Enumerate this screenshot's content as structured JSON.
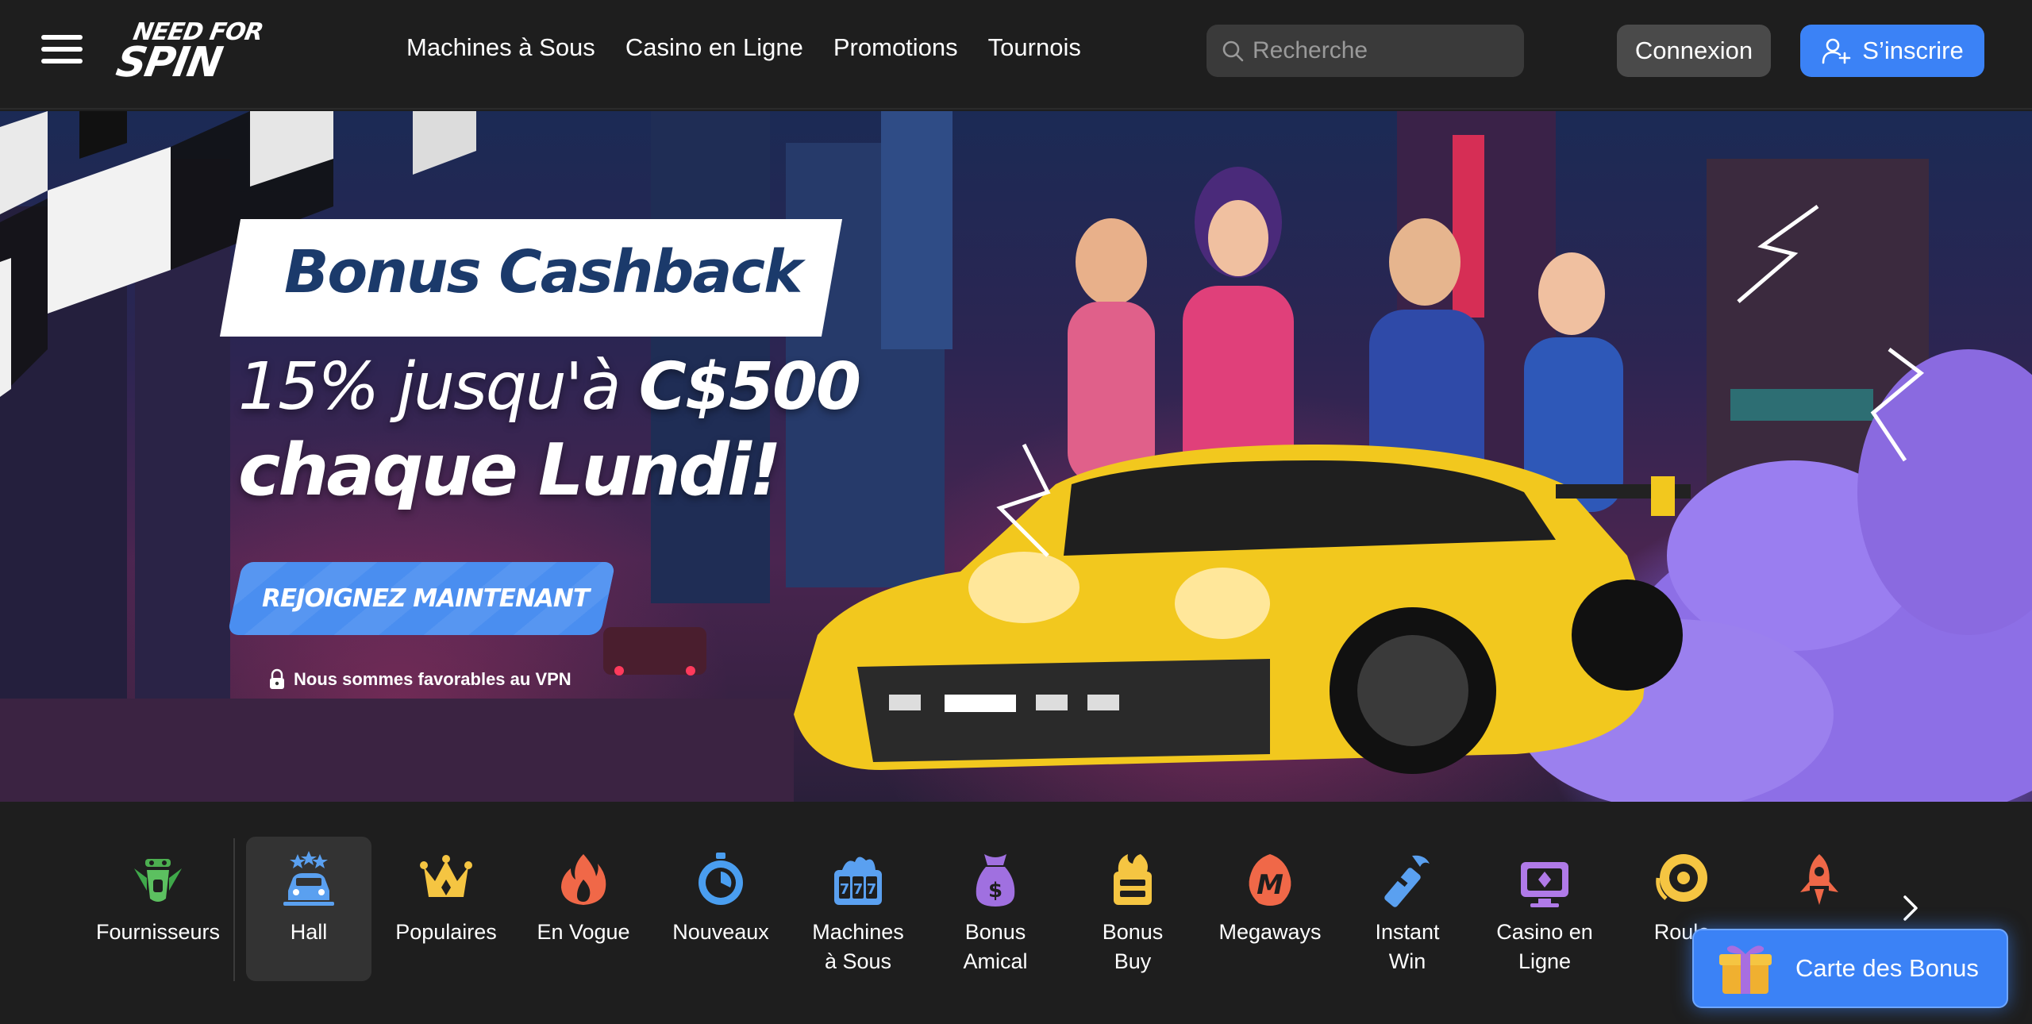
{
  "header": {
    "logo_top": "NEED FOR",
    "logo_bottom": "SPIN",
    "nav": [
      "Machines à Sous",
      "Casino en Ligne",
      "Promotions",
      "Tournois"
    ],
    "search_placeholder": "Recherche",
    "login_label": "Connexion",
    "signup_label": "S’inscrire"
  },
  "hero": {
    "badge": "Bonus Cashback",
    "line1_a": "15% jusqu'à ",
    "line1_b": "C$500",
    "line2": "chaque Lundi!",
    "cta": "REJOIGNEZ MAINTENANT",
    "vpn_note": "Nous sommes favorables au VPN"
  },
  "categories": [
    {
      "label": "Fournisseurs",
      "icon": "providers-icon",
      "color": "#4caf50"
    },
    {
      "label": "Hall",
      "icon": "hall-car-icon",
      "color": "#5aa0f0",
      "active": true
    },
    {
      "label": "Populaires",
      "icon": "crown-icon",
      "color": "#f5c542"
    },
    {
      "label": "En Vogue",
      "icon": "fire-icon",
      "color": "#f06848"
    },
    {
      "label": "Nouveaux",
      "icon": "stopwatch-icon",
      "color": "#4a9ef0"
    },
    {
      "label": "Machines\nà Sous",
      "icon": "slots-777-icon",
      "color": "#5aa0f0"
    },
    {
      "label": "Bonus\nAmical",
      "icon": "bonus-bag-icon",
      "color": "#a070e0"
    },
    {
      "label": "Bonus\nBuy",
      "icon": "bonus-buy-icon",
      "color": "#f5c542"
    },
    {
      "label": "Megaways",
      "icon": "megaways-icon",
      "color": "#f06848"
    },
    {
      "label": "Instant\nWin",
      "icon": "instant-win-icon",
      "color": "#5aa0f0"
    },
    {
      "label": "Casino en\nLigne",
      "icon": "live-casino-icon",
      "color": "#b07ae8"
    },
    {
      "label": "Roule",
      "icon": "roulette-wheel-icon",
      "color": "#f5c542"
    },
    {
      "label": "",
      "icon": "rocket-icon",
      "color": "#f06848"
    }
  ],
  "bonus_map": {
    "label": "Carte des Bonus",
    "icon": "gift-icon"
  },
  "colors": {
    "accent": "#3b82f6",
    "background": "#1e1e1e",
    "active_tile": "#333333"
  }
}
